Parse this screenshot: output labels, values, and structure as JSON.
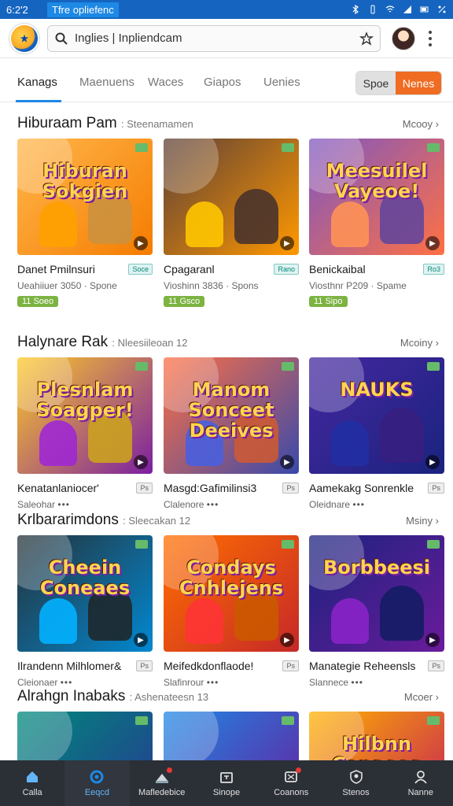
{
  "status_bar": {
    "time": "6:2'2",
    "app_name": "Tfre opliefenc"
  },
  "header": {
    "search_value": "Inglies | Inpliendcam"
  },
  "tabs": [
    {
      "label": "Kanags",
      "active": true
    },
    {
      "label": "Maenuens",
      "active": false
    },
    {
      "label": "Waces",
      "active": false
    },
    {
      "label": "Giapos",
      "active": false
    },
    {
      "label": "Uenies",
      "active": false
    }
  ],
  "segment": {
    "left": "Spoe",
    "right": "Nenes"
  },
  "sections": [
    {
      "title": "Hiburaam Pam",
      "subtitle": ": Steenamamen",
      "more": "Mcooy",
      "cards": [
        {
          "title": "Danet Pmilnsuri",
          "chip": "Soce",
          "meta": "Ueahiiuer 3050 · Spone",
          "price": "11 Soeo",
          "art": "Hiburan Sokgien",
          "colors": [
            "#ffb74d",
            "#f57c00"
          ]
        },
        {
          "title": "Cpagaranl",
          "chip": "Rano",
          "meta": "Vioshinn 3836 · Spons",
          "price": "11 Gsco",
          "art": "",
          "colors": [
            "#5d4037",
            "#ff9800"
          ]
        },
        {
          "title": "Benickaibal",
          "chip": "Ro3",
          "meta": "Viosthnr P209 · Spame",
          "price": "11 Sipo",
          "art": "Meesuilel Vayeoe!",
          "colors": [
            "#7e57c2",
            "#ff7043"
          ]
        }
      ]
    },
    {
      "title": "Halynare Rak",
      "subtitle": ": Nleesiileoan 12",
      "more": "Mcoiny",
      "cards": [
        {
          "title": "Kenatanlaniocer'",
          "chip": "Ps",
          "meta": "Saleohar",
          "dots": "•••",
          "art": "Plesnlam Soagper!",
          "colors": [
            "#ffca28",
            "#7b1fa2"
          ]
        },
        {
          "title": "Masgd:Gafimilinsi3",
          "chip": "Ps",
          "meta": "Clalenore",
          "dots": "•••",
          "art": "Manom Sonceet Deeives",
          "colors": [
            "#ff7043",
            "#3949ab"
          ]
        },
        {
          "title": "Aamekakg Sonrenkle",
          "chip": "Ps",
          "meta": "Oleidnare",
          "dots": "•••",
          "art": "NAUKS",
          "colors": [
            "#4527a0",
            "#1a237e"
          ]
        }
      ]
    },
    {
      "title": "Krlbararimdons",
      "subtitle": ": Sleecakan 12",
      "more": "Msiny",
      "cards": [
        {
          "title": "Ilrandenn Milhlomer&",
          "chip": "Ps",
          "meta": "Cleionaer",
          "dots": "•••",
          "art": "Cheein Coneaes",
          "colors": [
            "#263238",
            "#0288d1"
          ]
        },
        {
          "title": "Meifedkdonflaode!",
          "chip": "Ps",
          "meta": "Slafinrour",
          "dots": "•••",
          "art": "Condays Cnhlejens",
          "colors": [
            "#ff6f00",
            "#c62828"
          ]
        },
        {
          "title": "Manategie Reheensls",
          "chip": "Ps",
          "meta": "Slannece",
          "dots": "•••",
          "art": "Borbbeesi",
          "colors": [
            "#1a237e",
            "#6a1b9a"
          ]
        }
      ]
    },
    {
      "title": "Alrahgn Inabaks",
      "subtitle": ": Ashenateesn 13",
      "more": "Mcoer",
      "cards": [
        {
          "title": "",
          "chip": "",
          "meta": "",
          "art": "",
          "colors": [
            "#00897b",
            "#283593"
          ]
        },
        {
          "title": "",
          "chip": "",
          "meta": "",
          "art": "",
          "colors": [
            "#1e88e5",
            "#6a1b9a"
          ]
        },
        {
          "title": "",
          "chip": "",
          "meta": "",
          "art": "Hilbnn Conaees",
          "colors": [
            "#ffb300",
            "#c2185b"
          ]
        }
      ]
    }
  ],
  "bottom_nav": [
    {
      "label": "Calla",
      "icon": "home-icon",
      "active": false,
      "dot": false
    },
    {
      "label": "Eeqcd",
      "icon": "explore-icon",
      "active": true,
      "dot": false
    },
    {
      "label": "Mafledebice",
      "icon": "store-icon",
      "active": false,
      "dot": true
    },
    {
      "label": "Sinope",
      "icon": "bag-icon",
      "active": false,
      "dot": false
    },
    {
      "label": "Coanons",
      "icon": "message-icon",
      "active": false,
      "dot": true
    },
    {
      "label": "Stenos",
      "icon": "shield-icon",
      "active": false,
      "dot": false
    },
    {
      "label": "Nanne",
      "icon": "profile-icon",
      "active": false,
      "dot": false
    }
  ]
}
